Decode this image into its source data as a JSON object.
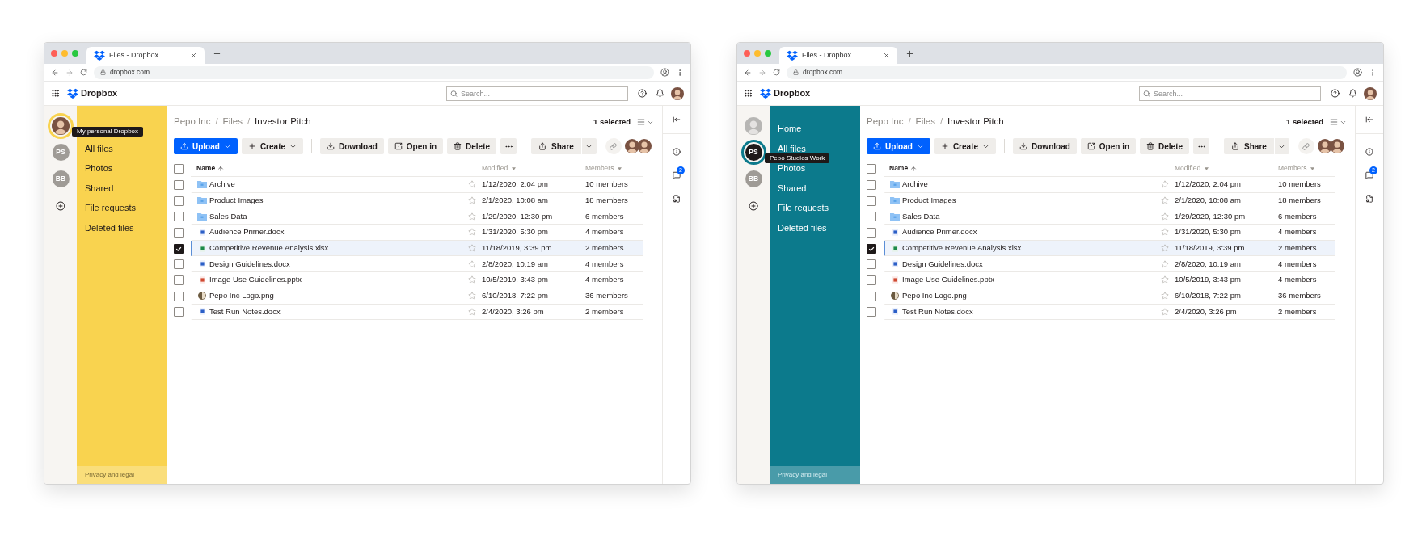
{
  "windows": [
    {
      "browser": {
        "tab_title": "Files - Dropbox",
        "url": "dropbox.com"
      },
      "app": {
        "logo": "Dropbox",
        "search_placeholder": "Search..."
      },
      "accounts": [
        {
          "kind": "photo",
          "selected": true
        },
        {
          "kind": "initials",
          "label": "PS",
          "selected": false
        },
        {
          "kind": "initials",
          "label": "BB",
          "selected": false
        },
        {
          "kind": "add"
        }
      ],
      "tooltip": "My personal Dropbox",
      "sidebar": {
        "color": "#f9d34f",
        "items": [
          {
            "label": "All files"
          },
          {
            "label": "Photos"
          },
          {
            "label": "Shared"
          },
          {
            "label": "File requests"
          },
          {
            "label": "Deleted files"
          }
        ],
        "footer": "Privacy and legal"
      },
      "breadcrumb": {
        "items": [
          "Pepo Inc",
          "Files",
          "Investor Pitch"
        ],
        "separator": "/"
      },
      "selection_count": "1 selected",
      "toolbar": [
        {
          "kind": "upload",
          "label": "Upload",
          "caret": true
        },
        {
          "kind": "create",
          "label": "Create",
          "caret": true
        },
        {
          "kind": "divider"
        },
        {
          "kind": "download",
          "label": "Download"
        },
        {
          "kind": "open",
          "label": "Open in"
        },
        {
          "kind": "delete",
          "label": "Delete"
        },
        {
          "kind": "more"
        },
        {
          "kind": "share",
          "label": "Share"
        },
        {
          "kind": "link"
        },
        {
          "kind": "members"
        }
      ],
      "table": {
        "all_checked": false,
        "columns": [
          {
            "label": "Name",
            "sorted": true
          },
          {
            "label": "Modified",
            "sorted": false
          },
          {
            "label": "Members",
            "sorted": false
          }
        ],
        "rows": [
          {
            "kind": "folder",
            "name": "Archive",
            "modified": "1/12/2020, 2:04 pm",
            "members": "10 members",
            "checked": false
          },
          {
            "kind": "folder",
            "name": "Product Images",
            "modified": "2/1/2020, 10:08 am",
            "members": "18 members",
            "checked": false
          },
          {
            "kind": "folder",
            "name": "Sales Data",
            "modified": "1/29/2020, 12:30 pm",
            "members": "6 members",
            "checked": false
          },
          {
            "kind": "docx",
            "name": "Audience Primer.docx",
            "modified": "1/31/2020, 5:30 pm",
            "members": "4 members",
            "checked": false
          },
          {
            "kind": "xlsx",
            "name": "Competitive Revenue Analysis.xlsx",
            "modified": "11/18/2019, 3:39 pm",
            "members": "2 members",
            "checked": true
          },
          {
            "kind": "docx",
            "name": "Design Guidelines.docx",
            "modified": "2/8/2020, 10:19 am",
            "members": "4 members",
            "checked": false
          },
          {
            "kind": "pptx",
            "name": "Image Use Guidelines.pptx",
            "modified": "10/5/2019, 3:43 pm",
            "members": "4 members",
            "checked": false
          },
          {
            "kind": "png",
            "name": "Pepo Inc Logo.png",
            "modified": "6/10/2018, 7:22 pm",
            "members": "36 members",
            "checked": false
          },
          {
            "kind": "docx",
            "name": "Test Run Notes.docx",
            "modified": "2/4/2020, 3:26 pm",
            "members": "2 members",
            "checked": false
          }
        ]
      },
      "comments_badge": "2"
    },
    {
      "browser": {
        "tab_title": "Files - Dropbox",
        "url": "dropbox.com"
      },
      "app": {
        "logo": "Dropbox",
        "search_placeholder": "Search..."
      },
      "accounts": [
        {
          "kind": "photo",
          "selected": false
        },
        {
          "kind": "initials",
          "label": "PS",
          "selected": true
        },
        {
          "kind": "initials",
          "label": "BB",
          "selected": false
        },
        {
          "kind": "add"
        }
      ],
      "tooltip": "Pepo Studios Work",
      "sidebar": {
        "color": "#0c7a8c",
        "items": [
          {
            "label": "Home"
          },
          {
            "label": "All files"
          },
          {
            "label": "Photos"
          },
          {
            "label": "Shared"
          },
          {
            "label": "File requests"
          },
          {
            "label": "Deleted files"
          }
        ],
        "footer": "Privacy and legal"
      },
      "breadcrumb": {
        "items": [
          "Pepo Inc",
          "Files",
          "Investor Pitch"
        ],
        "separator": "/"
      },
      "selection_count": "1 selected",
      "toolbar": [
        {
          "kind": "upload",
          "label": "Upload",
          "caret": true
        },
        {
          "kind": "create",
          "label": "Create",
          "caret": true
        },
        {
          "kind": "divider"
        },
        {
          "kind": "download",
          "label": "Download"
        },
        {
          "kind": "open",
          "label": "Open in"
        },
        {
          "kind": "delete",
          "label": "Delete"
        },
        {
          "kind": "more"
        },
        {
          "kind": "share",
          "label": "Share"
        },
        {
          "kind": "link"
        },
        {
          "kind": "members"
        }
      ],
      "table": {
        "all_checked": false,
        "columns": [
          {
            "label": "Name",
            "sorted": true
          },
          {
            "label": "Modified",
            "sorted": false
          },
          {
            "label": "Members",
            "sorted": false
          }
        ],
        "rows": [
          {
            "kind": "folder",
            "name": "Archive",
            "modified": "1/12/2020, 2:04 pm",
            "members": "10 members",
            "checked": false
          },
          {
            "kind": "folder",
            "name": "Product Images",
            "modified": "2/1/2020, 10:08 am",
            "members": "18 members",
            "checked": false
          },
          {
            "kind": "folder",
            "name": "Sales Data",
            "modified": "1/29/2020, 12:30 pm",
            "members": "6 members",
            "checked": false
          },
          {
            "kind": "docx",
            "name": "Audience Primer.docx",
            "modified": "1/31/2020, 5:30 pm",
            "members": "4 members",
            "checked": false
          },
          {
            "kind": "xlsx",
            "name": "Competitive Revenue Analysis.xlsx",
            "modified": "11/18/2019, 3:39 pm",
            "members": "2 members",
            "checked": true
          },
          {
            "kind": "docx",
            "name": "Design Guidelines.docx",
            "modified": "2/8/2020, 10:19 am",
            "members": "4 members",
            "checked": false
          },
          {
            "kind": "pptx",
            "name": "Image Use Guidelines.pptx",
            "modified": "10/5/2019, 3:43 pm",
            "members": "4 members",
            "checked": false
          },
          {
            "kind": "png",
            "name": "Pepo Inc Logo.png",
            "modified": "6/10/2018, 7:22 pm",
            "members": "36 members",
            "checked": false
          },
          {
            "kind": "docx",
            "name": "Test Run Notes.docx",
            "modified": "2/4/2020, 3:26 pm",
            "members": "2 members",
            "checked": false
          }
        ]
      },
      "comments_badge": "2"
    }
  ]
}
